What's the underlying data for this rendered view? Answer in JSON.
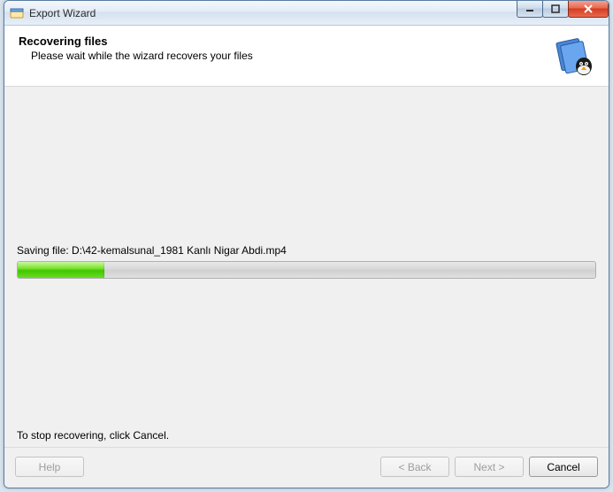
{
  "window": {
    "title": "Export Wizard"
  },
  "header": {
    "heading": "Recovering files",
    "subtext": "Please wait while the wizard recovers your files"
  },
  "progress": {
    "status_prefix": "Saving file: ",
    "current_file": "D:\\42-kemalsunal_1981 Kanlı Nigar Abdi.mp4",
    "percent": 15,
    "stop_hint": "To stop recovering, click Cancel."
  },
  "buttons": {
    "help": "Help",
    "back": "< Back",
    "next": "Next >",
    "cancel": "Cancel"
  }
}
